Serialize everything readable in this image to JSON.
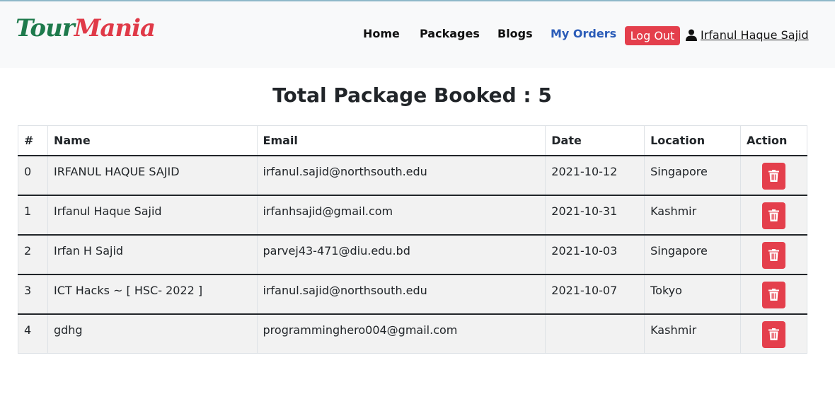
{
  "brand": {
    "part1": "Tour",
    "part2": "Mania"
  },
  "nav": {
    "home": "Home",
    "packages": "Packages",
    "blogs": "Blogs",
    "my_orders": "My Orders"
  },
  "auth": {
    "logout_label": "Log Out",
    "user_name": "Irfanul Haque Sajid"
  },
  "page_title": "Total Package Booked : 5",
  "table": {
    "headers": [
      "#",
      "Name",
      "Email",
      "Date",
      "Location",
      "Action"
    ],
    "rows": [
      {
        "index": "0",
        "name": "IRFANUL HAQUE SAJID",
        "email": "irfanul.sajid@northsouth.edu",
        "date": "2021-10-12",
        "location": "Singapore"
      },
      {
        "index": "1",
        "name": "Irfanul Haque Sajid",
        "email": "irfanhsajid@gmail.com",
        "date": "2021-10-31",
        "location": "Kashmir"
      },
      {
        "index": "2",
        "name": "Irfan H Sajid",
        "email": "parvej43-471@diu.edu.bd",
        "date": "2021-10-03",
        "location": "Singapore"
      },
      {
        "index": "3",
        "name": "ICT Hacks ~ [ HSC- 2022 ]",
        "email": "irfanul.sajid@northsouth.edu",
        "date": "2021-10-07",
        "location": "Tokyo"
      },
      {
        "index": "4",
        "name": "gdhg",
        "email": "programminghero004@gmail.com",
        "date": "",
        "location": "Kashmir"
      }
    ]
  },
  "colors": {
    "danger": "#e43f4c",
    "active_link": "#2b5cb8",
    "brand_green": "#1e7a4c",
    "brand_red": "#e03a48"
  },
  "icons": {
    "user": "user-icon",
    "delete": "trash-icon"
  }
}
